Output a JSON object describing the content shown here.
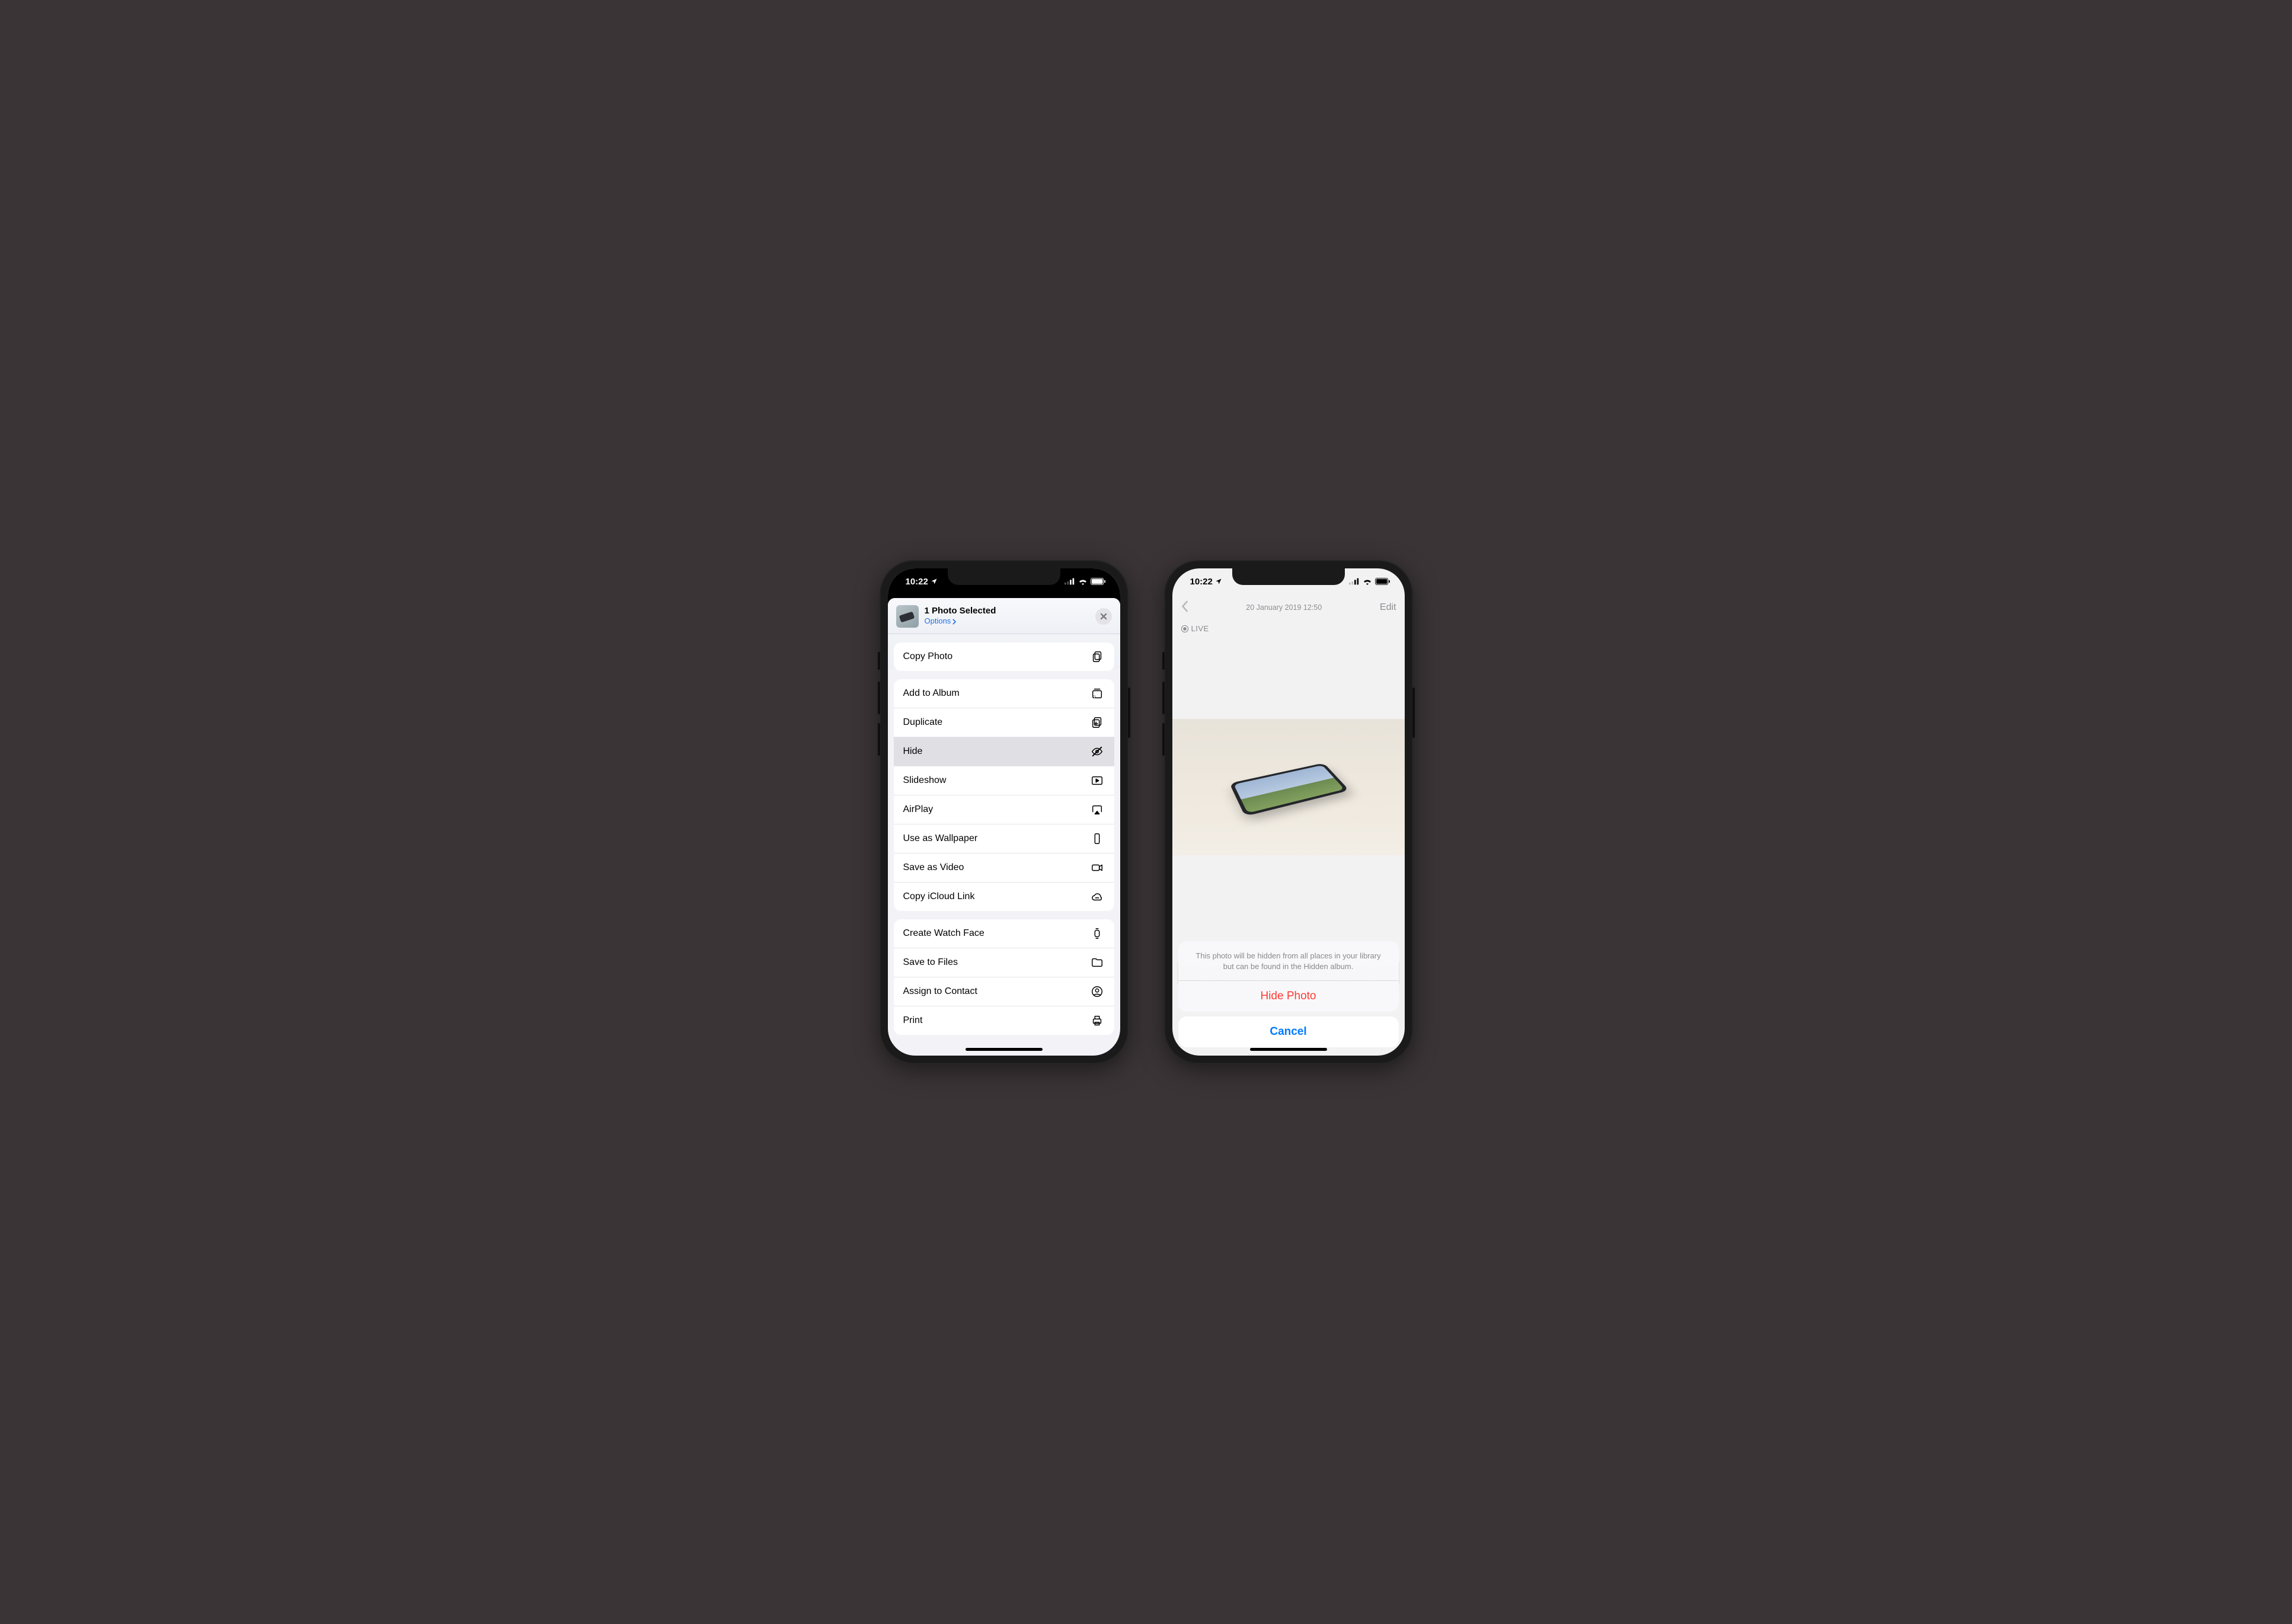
{
  "status": {
    "time": "10:22"
  },
  "share": {
    "title": "1 Photo Selected",
    "options": "Options",
    "groups": [
      {
        "rows": [
          {
            "label": "Copy Photo",
            "icon": "copy"
          }
        ]
      },
      {
        "rows": [
          {
            "label": "Add to Album",
            "icon": "album"
          },
          {
            "label": "Duplicate",
            "icon": "duplicate"
          },
          {
            "label": "Hide",
            "icon": "hide",
            "selected": true
          },
          {
            "label": "Slideshow",
            "icon": "play"
          },
          {
            "label": "AirPlay",
            "icon": "airplay"
          },
          {
            "label": "Use as Wallpaper",
            "icon": "phone"
          },
          {
            "label": "Save as Video",
            "icon": "video"
          },
          {
            "label": "Copy iCloud Link",
            "icon": "cloud"
          }
        ]
      },
      {
        "rows": [
          {
            "label": "Create Watch Face",
            "icon": "watch"
          },
          {
            "label": "Save to Files",
            "icon": "folder"
          },
          {
            "label": "Assign to Contact",
            "icon": "contact"
          },
          {
            "label": "Print",
            "icon": "print"
          }
        ]
      }
    ]
  },
  "detail": {
    "date": "20 January 2019  12:50",
    "edit": "Edit",
    "live": "LIVE",
    "message": "This photo will be hidden from all places in your library but can be found in the Hidden album.",
    "hide": "Hide Photo",
    "cancel": "Cancel"
  }
}
